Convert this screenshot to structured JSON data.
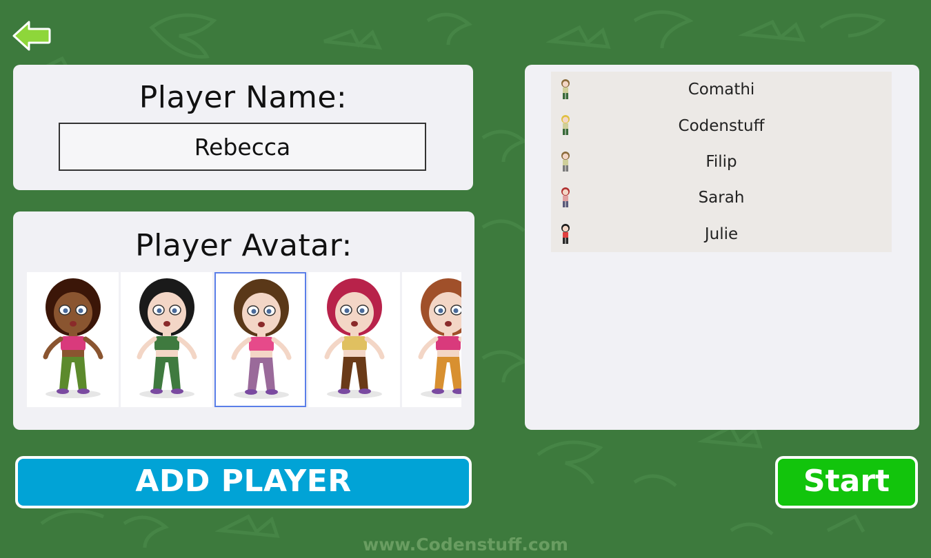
{
  "header": {
    "back_icon": "back-arrow-icon"
  },
  "name_panel": {
    "title": "Player Name:",
    "input_value": "Rebecca"
  },
  "avatar_panel": {
    "title": "Player Avatar:",
    "selected_index": 2,
    "avatars": [
      {
        "name": "avatar-curly-hair",
        "hair": "#3b1608",
        "skin": "#8a5530",
        "top": "#d93a7c",
        "pants": "#5c8a2c"
      },
      {
        "name": "avatar-black-bob",
        "hair": "#1a1a1a",
        "skin": "#f3d6c6",
        "top": "#3f7a3f",
        "pants": "#3f7a3f"
      },
      {
        "name": "avatar-long-brown",
        "hair": "#5a3818",
        "skin": "#f3d6c6",
        "top": "#e64a8a",
        "pants": "#9a6a9a"
      },
      {
        "name": "avatar-red-headband",
        "hair": "#b8224a",
        "skin": "#f3d6c6",
        "top": "#e0c060",
        "pants": "#6a3a18"
      },
      {
        "name": "avatar-bun-hair",
        "hair": "#a0502a",
        "skin": "#f3d6c6",
        "top": "#d93a7c",
        "pants": "#d89030"
      }
    ]
  },
  "players": [
    {
      "name": "Comathi",
      "hair": "#8a6a3a",
      "top": "#cfcf9a",
      "pants": "#3a6a3a"
    },
    {
      "name": "Codenstuff",
      "hair": "#e0c040",
      "top": "#cfcf9a",
      "pants": "#3a6a3a"
    },
    {
      "name": "Filip",
      "hair": "#8a6a3a",
      "top": "#cfcf9a",
      "pants": "#7a7a7a"
    },
    {
      "name": "Sarah",
      "hair": "#b03030",
      "top": "#e0a0a0",
      "pants": "#5a5a7a"
    },
    {
      "name": "Julie",
      "hair": "#1a1a1a",
      "top": "#e04040",
      "pants": "#2a2a2a"
    }
  ],
  "buttons": {
    "add_player": "ADD PLAYER",
    "start": "Start"
  },
  "footer": {
    "url": "www.Codenstuff.com"
  },
  "colors": {
    "background": "#3d7a3d",
    "add_button": "#01a3d6",
    "start_button": "#12c40c",
    "selected_outline": "#5a7ee8"
  }
}
